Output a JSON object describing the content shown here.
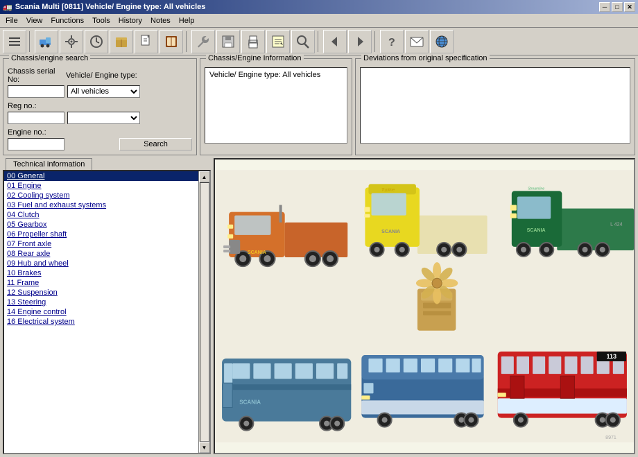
{
  "titleBar": {
    "icon": "🚛",
    "title": "Scania Multi   [0811]   Vehicle/ Engine type: All vehicles",
    "minBtn": "─",
    "maxBtn": "□",
    "closeBtn": "✕"
  },
  "menu": {
    "items": [
      "File",
      "View",
      "Functions",
      "Tools",
      "History",
      "Notes",
      "Help"
    ]
  },
  "searchPanel": {
    "legend": "Chassis/engine search",
    "chassisSerialLabel": "Chassis serial No:",
    "vehicleEngineTypeLabel": "Vehicle/ Engine type:",
    "vehicleEngineTypeValue": "All vehicles",
    "regNoLabel": "Reg no.:",
    "engineNoLabel": "Engine no.:",
    "searchBtn": "Search"
  },
  "chassisInfoPanel": {
    "legend": "Chassis/Engine Information",
    "text": "Vehicle/ Engine type: All vehicles"
  },
  "deviationsPanel": {
    "legend": "Deviations from original specification"
  },
  "techInfo": {
    "tabLabel": "Technical information",
    "items": [
      {
        "id": "00",
        "label": "General",
        "selected": true
      },
      {
        "id": "01",
        "label": "Engine"
      },
      {
        "id": "02",
        "label": "Cooling system"
      },
      {
        "id": "03",
        "label": "Fuel and exhaust systems"
      },
      {
        "id": "04",
        "label": "Clutch"
      },
      {
        "id": "05",
        "label": "Gearbox"
      },
      {
        "id": "06",
        "label": "Propeller shaft"
      },
      {
        "id": "07",
        "label": "Front axle"
      },
      {
        "id": "08",
        "label": "Rear axle"
      },
      {
        "id": "09",
        "label": "Hub and wheel"
      },
      {
        "id": "10",
        "label": "Brakes"
      },
      {
        "id": "11",
        "label": "Frame"
      },
      {
        "id": "12",
        "label": "Suspension"
      },
      {
        "id": "13",
        "label": "Steering"
      },
      {
        "id": "14",
        "label": "Engine control"
      },
      {
        "id": "16",
        "label": "Electrical system"
      }
    ]
  }
}
